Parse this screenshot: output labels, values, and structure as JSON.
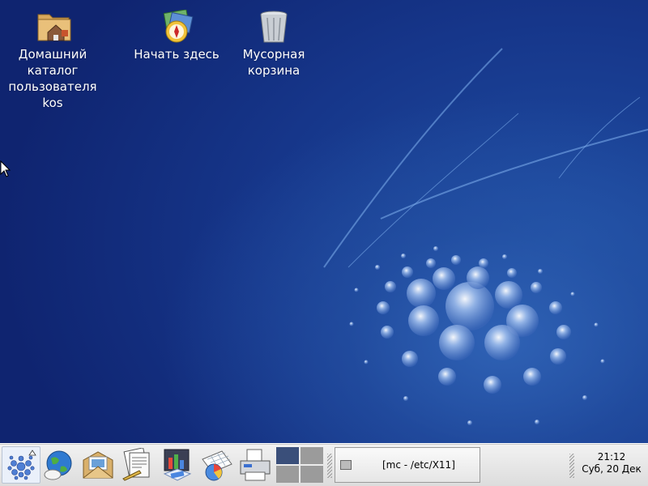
{
  "desktop": {
    "icons": [
      {
        "label": "Домашний\nкаталог\nпользователя kos",
        "icon": "home-folder-icon"
      },
      {
        "label": "Начать здесь",
        "icon": "compass-icon"
      },
      {
        "label": "Мусорная\nкорзина",
        "icon": "trash-icon"
      }
    ]
  },
  "panel": {
    "launchers": [
      "kmenu-icon",
      "web-browser-icon",
      "mail-icon",
      "word-processor-icon",
      "presentation-icon",
      "spreadsheet-icon",
      "printer-icon"
    ],
    "taskbar": {
      "window_title": "[mc - /etc/X11]"
    },
    "clock": {
      "time": "21:12",
      "date": "Суб, 20 Дек"
    }
  },
  "colors": {
    "desktop": "#14307f",
    "panel": "#e6e6e6",
    "active_desktop": "#3a4f7a"
  }
}
